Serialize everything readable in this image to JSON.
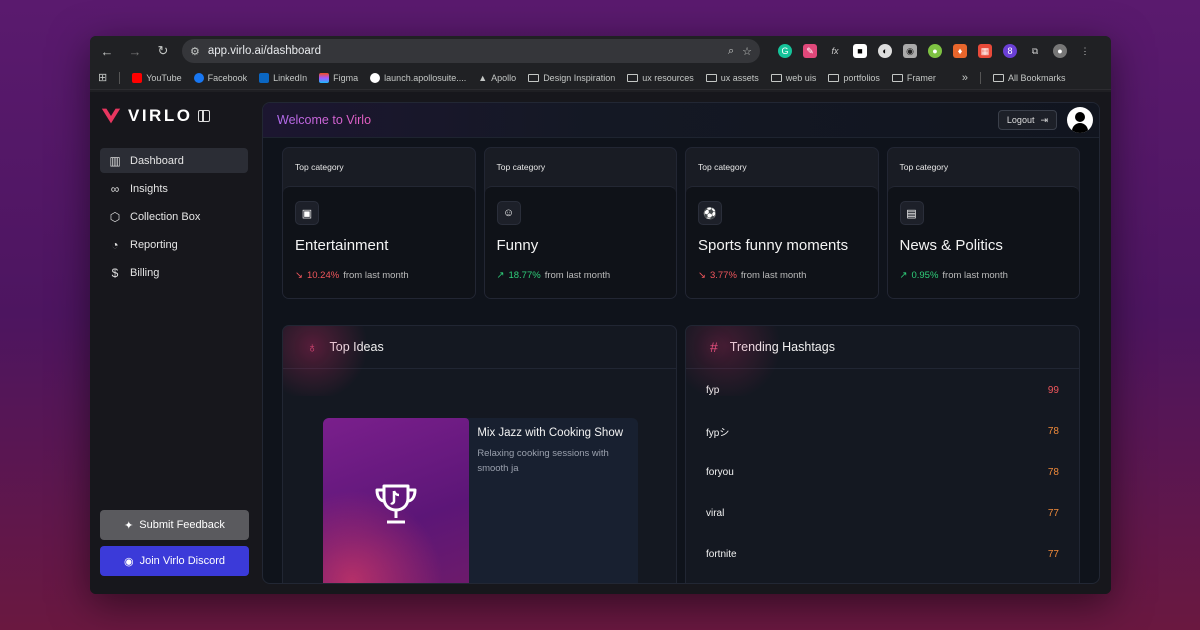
{
  "browser": {
    "url": "app.virlo.ai/dashboard",
    "bookmarks": [
      {
        "label": "YouTube",
        "icon": "youtube-icon",
        "color": "#ff0000"
      },
      {
        "label": "Facebook",
        "icon": "facebook-icon",
        "color": "#1877f2"
      },
      {
        "label": "LinkedIn",
        "icon": "linkedin-icon",
        "color": "#0a66c2"
      },
      {
        "label": "Figma",
        "icon": "figma-icon",
        "color": "#a259ff"
      },
      {
        "label": "launch.apollosuite....",
        "icon": "github-icon",
        "color": "#ffffff"
      },
      {
        "label": "Apollo",
        "icon": "apollo-icon",
        "color": "#888888"
      },
      {
        "label": "Design Inspiration",
        "icon": "folder-icon"
      },
      {
        "label": "ux resources",
        "icon": "folder-icon"
      },
      {
        "label": "ux assets",
        "icon": "folder-icon"
      },
      {
        "label": "web uis",
        "icon": "folder-icon"
      },
      {
        "label": "portfolios",
        "icon": "folder-icon"
      },
      {
        "label": "Framer",
        "icon": "folder-icon"
      }
    ],
    "more": "»",
    "all_bookmarks": "All Bookmarks"
  },
  "sidebar": {
    "brand": "VIRLO",
    "brand_color": "#e8365f",
    "items": [
      {
        "label": "Dashboard",
        "icon": "chart-icon",
        "active": true
      },
      {
        "label": "Insights",
        "icon": "glasses-icon"
      },
      {
        "label": "Collection Box",
        "icon": "box-icon"
      },
      {
        "label": "Reporting",
        "icon": "pie-chart-icon"
      },
      {
        "label": "Billing",
        "icon": "dollar-icon"
      }
    ],
    "feedback_label": "Submit Feedback",
    "discord_label": "Join Virlo Discord"
  },
  "header": {
    "welcome": "Welcome to Virlo",
    "logout": "Logout"
  },
  "categories": [
    {
      "head": "Top category",
      "title": "Entertainment",
      "change": "10.24%",
      "direction": "down",
      "suffix": "from last month",
      "icon": "theater-icon"
    },
    {
      "head": "Top category",
      "title": "Funny",
      "change": "18.77%",
      "direction": "up",
      "suffix": "from last month",
      "icon": "laugh-icon"
    },
    {
      "head": "Top category",
      "title": "Sports funny moments",
      "change": "3.77%",
      "direction": "down",
      "suffix": "from last month",
      "icon": "soccer-ball-icon"
    },
    {
      "head": "Top category",
      "title": "News & Politics",
      "change": "0.95%",
      "direction": "up",
      "suffix": "from last month",
      "icon": "newspaper-icon"
    }
  ],
  "top_ideas": {
    "title": "Top Ideas",
    "idea": {
      "title": "Mix Jazz with Cooking Show",
      "description": "Relaxing cooking sessions with smooth ja"
    }
  },
  "trending": {
    "title": "Trending Hashtags",
    "tags": [
      {
        "tag": "fyp",
        "count": "99"
      },
      {
        "tag": "fypシ",
        "count": "78"
      },
      {
        "tag": "foryou",
        "count": "78"
      },
      {
        "tag": "viral",
        "count": "77"
      },
      {
        "tag": "fortnite",
        "count": "77"
      }
    ]
  }
}
